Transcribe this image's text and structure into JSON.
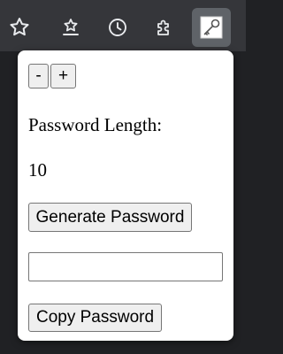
{
  "toolbar": {
    "icons": [
      "star-icon",
      "reading-list-icon",
      "history-icon",
      "extensions-icon",
      "password-generator-extension-icon"
    ]
  },
  "popup": {
    "decrease_label": "-",
    "increase_label": "+",
    "length_label": "Password Length:",
    "length_value": "10",
    "generate_label": "Generate Password",
    "password_value": "",
    "copy_label": "Copy Password"
  },
  "colors": {
    "toolbar_bg": "#35363a",
    "active_icon_bg": "#5f6368",
    "popup_bg": "#ffffff"
  }
}
